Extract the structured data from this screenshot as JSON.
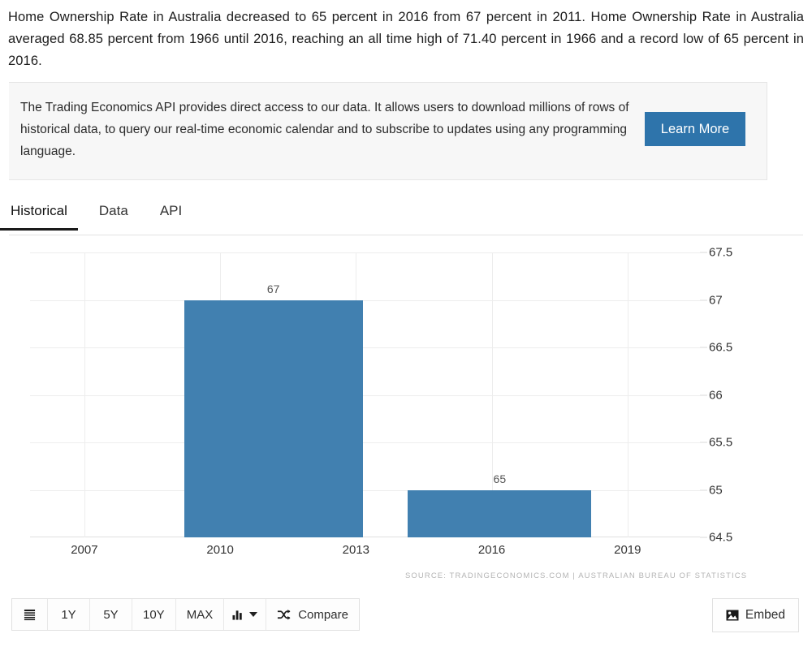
{
  "intro": {
    "paragraph": "Home Ownership Rate in Australia decreased to 65 percent in 2016 from 67 percent in 2011. Home Ownership Rate in Australia averaged 68.85 percent from 1966 until 2016, reaching an all time high of 71.40 percent in 1966 and a record low of 65 percent in 2016."
  },
  "promo": {
    "text": "The Trading Economics API provides direct access to our data. It allows users to download millions of rows of historical data, to query our real-time economic calendar and to subscribe to updates using any programming language.",
    "button_label": "Learn More",
    "button_color": "#2e74ab"
  },
  "tabs": [
    {
      "label": "Historical",
      "active": true
    },
    {
      "label": "Data",
      "active": false
    },
    {
      "label": "API",
      "active": false
    }
  ],
  "toolbar": {
    "menu_icon": "list-icon",
    "ranges": [
      "1Y",
      "5Y",
      "10Y",
      "MAX"
    ],
    "chart_type_icon": "bar-chart-icon",
    "compare_icon": "shuffle-icon",
    "compare_label": "Compare",
    "embed_icon": "image-icon",
    "embed_label": "Embed"
  },
  "chart_data": {
    "type": "bar",
    "title": "",
    "xlabel": "",
    "ylabel": "",
    "categories": [
      "2011",
      "2016"
    ],
    "values": [
      67,
      65
    ],
    "bar_labels": [
      "67",
      "65"
    ],
    "bar_color": "#4180b0",
    "ylim": [
      64.5,
      67.5
    ],
    "yticks": [
      "67.5",
      "67",
      "66.5",
      "66",
      "65.5",
      "65",
      "64.5"
    ],
    "ytick_values": [
      67.5,
      67,
      66.5,
      66,
      65.5,
      65,
      64.5
    ],
    "xticks": [
      "2007",
      "2010",
      "2013",
      "2016",
      "2019"
    ],
    "xtick_values": [
      2007,
      2010,
      2013,
      2016,
      2019
    ],
    "grid": true,
    "legend": false,
    "source": "SOURCE: TRADINGECONOMICS.COM | AUSTRALIAN BUREAU OF STATISTICS"
  }
}
